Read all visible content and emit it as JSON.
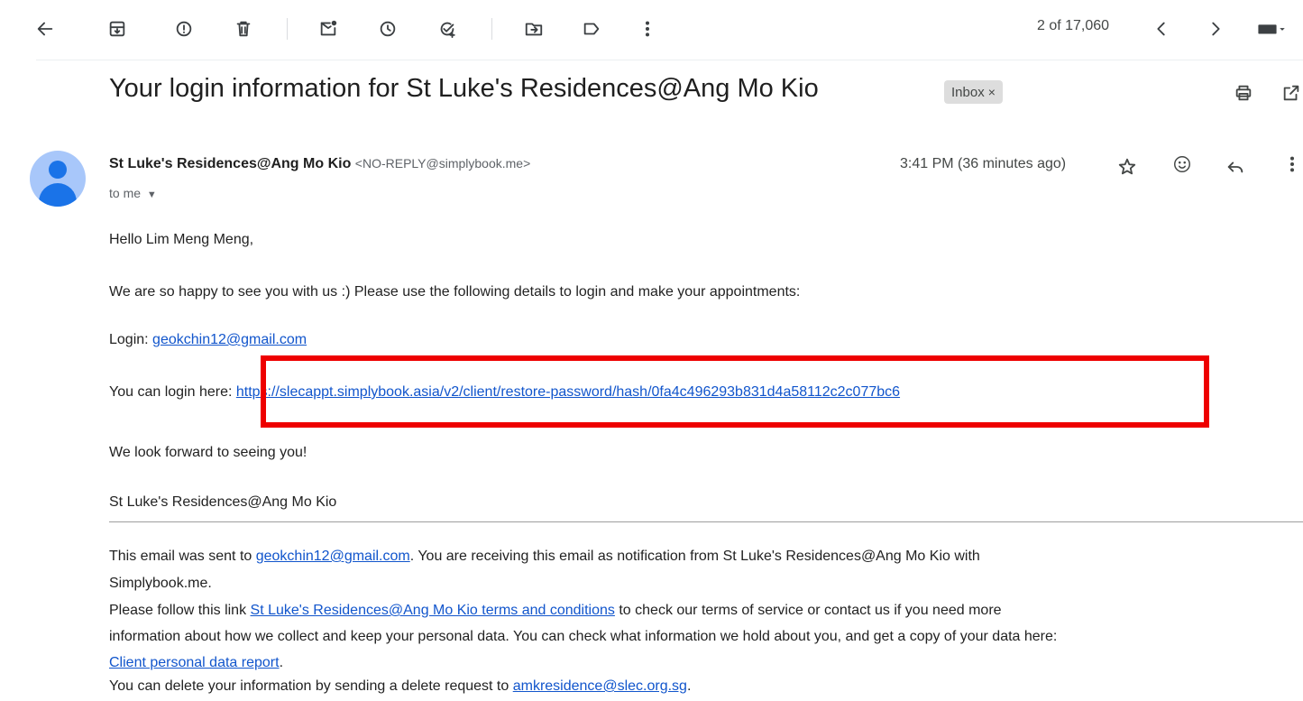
{
  "toolbar": {
    "icons": [
      "back-icon",
      "archive-icon",
      "report-spam-icon",
      "delete-icon",
      "mark-unread-icon",
      "snooze-icon",
      "add-to-tasks-icon",
      "move-to-icon",
      "label-icon",
      "more-icon"
    ],
    "counter": "2 of 17,060",
    "nav": [
      "newer-icon",
      "older-icon",
      "input-tools-icon"
    ]
  },
  "email": {
    "subject": "Your login information for St Luke's Residences@Ang Mo Kio",
    "label": "Inbox",
    "label_close": "×",
    "sender_name": "St Luke's Residences@Ang Mo Kio",
    "sender_email": "<NO-REPLY@simplybook.me>",
    "to": "to me",
    "time": "3:41 PM (36 minutes ago)"
  },
  "body": {
    "greeting": "Hello Lim Meng Meng,",
    "intro": "We are so happy to see you with us :) Please use the following details to login and make your appointments:",
    "login_label": "Login: ",
    "login_email": "geokchin12@gmail.com",
    "login_here": "You can login here: ",
    "login_link": "https://slecappt.simplybook.asia/v2/client/restore-password/hash/0fa4c496293b831d4a58112c2c077bc6",
    "look_forward": "We look forward to seeing you!",
    "signature": "St Luke's Residences@Ang Mo Kio"
  },
  "footer": {
    "sent_to_pre": "This email was sent to ",
    "sent_to_email": "geokchin12@gmail.com",
    "sent_to_post": ". You are receiving this email as notification from St Luke's Residences@Ang Mo Kio with",
    "sent_to_line2": "Simplybook.me.",
    "follow_pre": "Please follow this link ",
    "terms_link": "St Luke's Residences@Ang Mo Kio terms and conditions",
    "follow_post": " to check our terms of service or contact us if you need more",
    "info_line": "information about how we collect and keep your personal data. You can check what information we hold about you, and get a copy of your data here:",
    "report_link": "Client personal data report",
    "report_post": ".",
    "delete_pre": "You can delete your information by sending a delete request to ",
    "delete_email": "amkresidence@slec.org.sg",
    "delete_post": "."
  },
  "colors": {
    "link": "#1155cc",
    "highlight": "#ee0000",
    "avatar_bg": "#a8c7fa",
    "avatar_fg": "#1a73e8"
  }
}
